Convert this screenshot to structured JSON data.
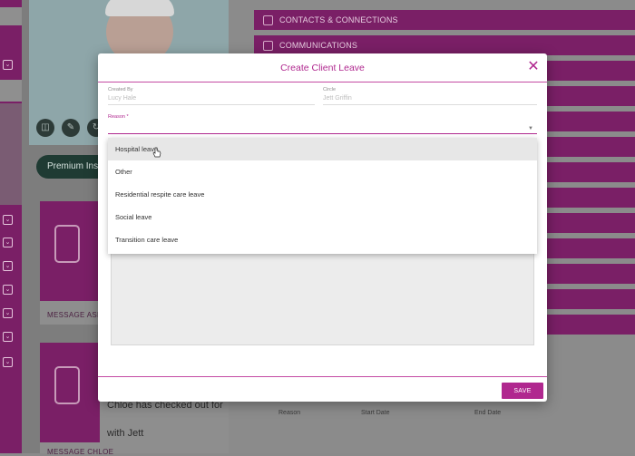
{
  "background": {
    "accordions": [
      "CONTACTS & CONNECTIONS",
      "COMMUNICATIONS"
    ],
    "premium_label": "Premium Insura",
    "card_captions": [
      "MESSAGE ASPEN",
      "MESSAGE CHLOE"
    ],
    "checkout_text_line1": "Chloe has checked out for",
    "checkout_text_line2": "with Jett",
    "table_headers": [
      "Reason",
      "Start Date",
      "End Date"
    ]
  },
  "modal": {
    "title": "Create Client Leave",
    "fields": {
      "created_by_label": "Created By",
      "created_by_value": "Lucy Hale",
      "circle_label": "Circle",
      "circle_value": "Jett Griffin",
      "reason_label": "Reason *"
    },
    "save_label": "SAVE"
  },
  "dropdown": {
    "options": [
      "Hospital leave",
      "Other",
      "Residential respite care leave",
      "Social leave",
      "Transition care leave"
    ],
    "hovered_index": 0
  },
  "colors": {
    "accent": "#b0288f",
    "background_magenta": "#7a1f66"
  }
}
